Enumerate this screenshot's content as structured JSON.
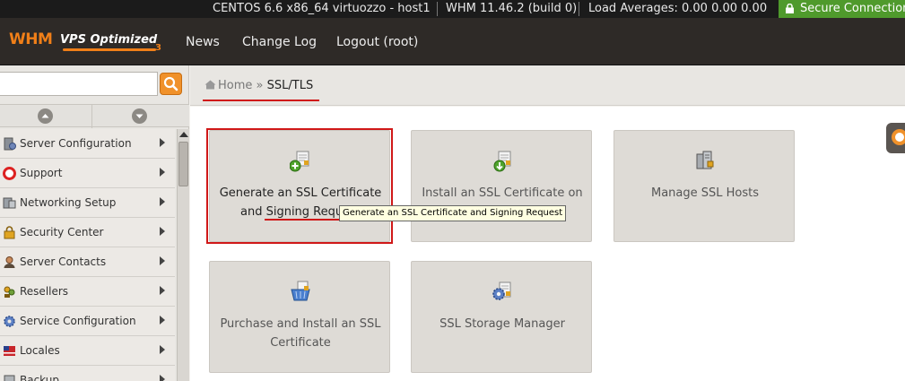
{
  "status_bar": {
    "os": "CENTOS 6.6 x86_64 virtuozzo - host1",
    "version": "WHM 11.46.2 (build 0)",
    "load": "Load Averages: 0.00 0.00 0.00",
    "secure": "Secure Connection"
  },
  "header": {
    "logo_whm": "WHM",
    "logo_vps": "VPS Optimized",
    "logo_num": "3",
    "nav": [
      "News",
      "Change Log",
      "Logout (root)"
    ]
  },
  "sidebar": {
    "search_value": "",
    "items": [
      {
        "label": "Server Configuration",
        "icon": "server-config-icon"
      },
      {
        "label": "Support",
        "icon": "support-icon"
      },
      {
        "label": "Networking Setup",
        "icon": "network-icon"
      },
      {
        "label": "Security Center",
        "icon": "lock-icon"
      },
      {
        "label": "Server Contacts",
        "icon": "contact-icon"
      },
      {
        "label": "Resellers",
        "icon": "resellers-icon"
      },
      {
        "label": "Service Configuration",
        "icon": "gear-icon"
      },
      {
        "label": "Locales",
        "icon": "flag-icon"
      },
      {
        "label": "Backup",
        "icon": "backup-icon"
      }
    ]
  },
  "breadcrumb": {
    "home": "Home",
    "separator": "»",
    "current": "SSL/TLS"
  },
  "tiles": [
    {
      "line1": "Generate an SSL Certificate",
      "line2": "and Signing Request",
      "icon": "generate-cert-icon"
    },
    {
      "line1": "Install an SSL Certificate on",
      "line2": "",
      "icon": "install-cert-icon"
    },
    {
      "line1": "Manage SSL Hosts",
      "line2": "",
      "icon": "manage-hosts-icon"
    },
    {
      "line1": "Purchase and Install an SSL",
      "line2": "Certificate",
      "icon": "purchase-cert-icon"
    },
    {
      "line1": "SSL Storage Manager",
      "line2": "",
      "icon": "storage-manager-icon"
    }
  ],
  "tooltip": "Generate an SSL Certificate and Signing Request",
  "colors": {
    "accent": "#f0912a",
    "highlight": "#d01818",
    "secure": "#4f9a2c"
  }
}
